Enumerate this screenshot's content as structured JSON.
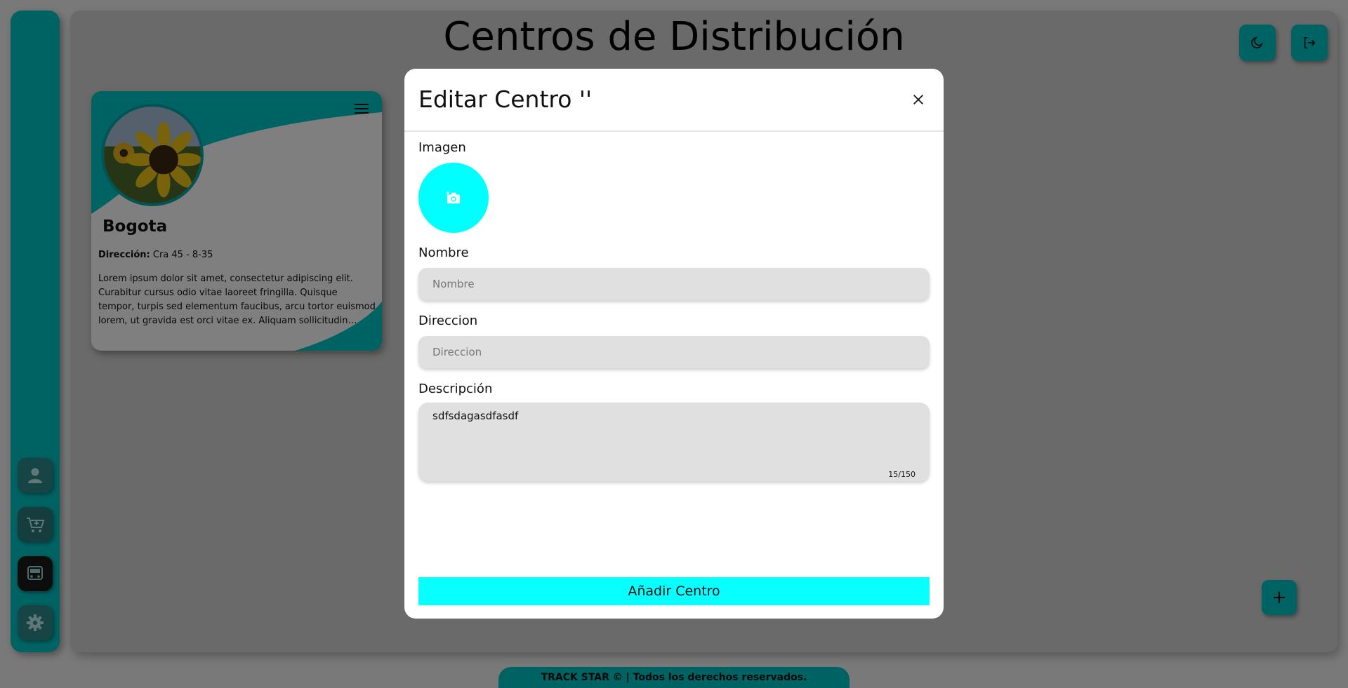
{
  "page": {
    "title": "Centros de Distribución"
  },
  "sidebar": {
    "items": [
      {
        "icon": "user-icon"
      },
      {
        "icon": "shopping-cart-icon"
      },
      {
        "icon": "truck-icon"
      },
      {
        "icon": "gear-icon"
      }
    ]
  },
  "header": {
    "theme_toggle_icon": "moon-icon",
    "logout_icon": "logout-icon"
  },
  "card": {
    "name": "Bogota",
    "direccion_label": "Dirección:",
    "direccion_value": "Cra 45 - 8-35",
    "description": "Lorem ipsum dolor sit amet, consectetur adipiscing elit. Curabitur cursus odio vitae laoreet fringilla. Quisque tempor, turpis sed elementum faucibus, arcu tortor euismod lorem, ut gravida est orci vitae ex. Aliquam sollicitudin blandit est ..."
  },
  "fab": {
    "label": "+"
  },
  "footer": {
    "text": "TRACK STAR © | Todos los derechos reservados."
  },
  "modal": {
    "title": "Editar Centro ''",
    "imagen_label": "Imagen",
    "nombre_label": "Nombre",
    "nombre_placeholder": "Nombre",
    "direccion_label": "Direccion",
    "direccion_placeholder": "Direccion",
    "descripcion_label": "Descripción",
    "descripcion_value": "sdfsdagasdfasdf",
    "counter": "15/150",
    "submit_label": "Añadir Centro"
  },
  "colors": {
    "accent": "#00c6c6",
    "accent_bright": "#00ffff",
    "input_bg": "#e0e0e0"
  }
}
